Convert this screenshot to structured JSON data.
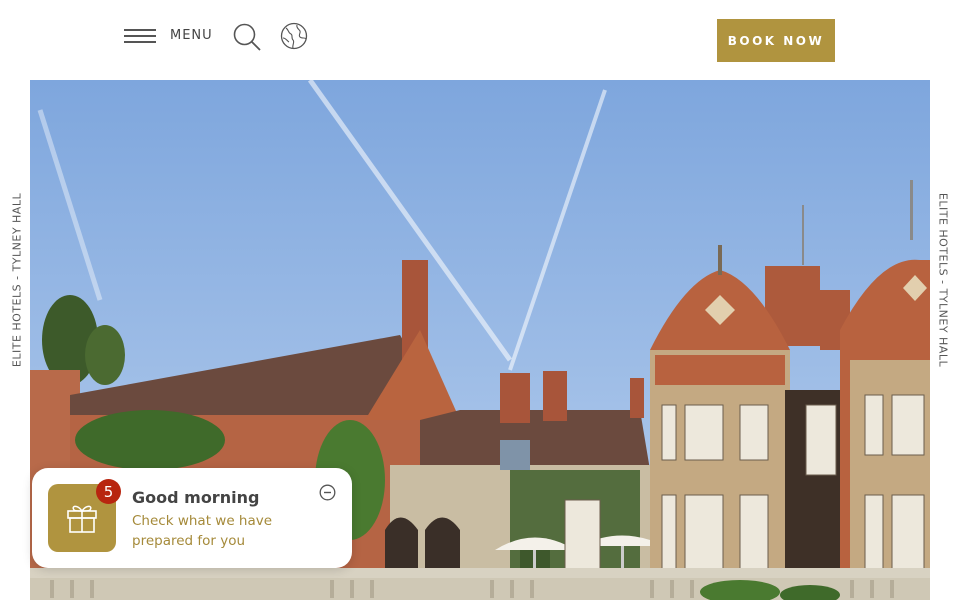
{
  "header": {
    "menu_label": "MENU",
    "book_label": "BOOK NOW",
    "icons": {
      "menu": "hamburger-icon",
      "search": "search-icon",
      "language": "globe-icon"
    }
  },
  "side_labels": {
    "left": "ELITE HOTELS - TYLNEY HALL",
    "right": "ELITE HOTELS - TYLNEY HALL"
  },
  "notification": {
    "badge_count": "5",
    "title": "Good morning",
    "text": "Check what we have prepared for you",
    "icon": "gift-icon",
    "collapse_icon": "minus-circle-icon"
  },
  "colors": {
    "accent": "#b0943f",
    "badge": "#b8250f",
    "sky": "#8fb3e2",
    "brick": "#b2623e"
  }
}
